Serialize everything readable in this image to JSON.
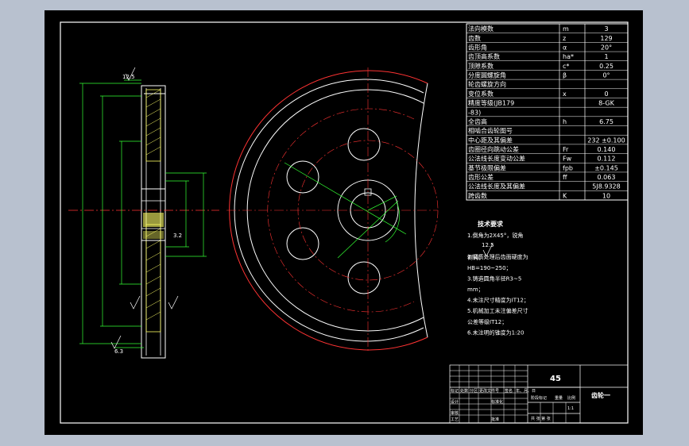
{
  "params": [
    {
      "name": "法向模数",
      "sym": "m",
      "val": "3"
    },
    {
      "name": "齿数",
      "sym": "z",
      "val": "129"
    },
    {
      "name": "齿形角",
      "sym": "α",
      "val": "20°"
    },
    {
      "name": "齿顶高系数",
      "sym": "ha*",
      "val": "1"
    },
    {
      "name": "顶隙系数",
      "sym": "c*",
      "val": "0.25"
    },
    {
      "name": "分度圆螺旋角",
      "sym": "β",
      "val": "0°"
    },
    {
      "name": "轮齿螺旋方向",
      "sym": "",
      "val": ""
    },
    {
      "name": "变位系数",
      "sym": "x",
      "val": "0"
    },
    {
      "name": "精度等级(JB179",
      "sym": "",
      "val": "8-GK"
    },
    {
      "name": "-83)",
      "sym": "",
      "val": ""
    },
    {
      "name": "全齿高",
      "sym": "h",
      "val": "6.75"
    },
    {
      "name": "相啮合齿轮图号",
      "sym": "",
      "val": ""
    },
    {
      "name": "中心距及其偏差",
      "sym": "",
      "val": "232 ±0.100"
    },
    {
      "name": "齿圈径向跳动公差",
      "sym": "Fr",
      "val": "0.140"
    },
    {
      "name": "公法线长度变动公差",
      "sym": "Fw",
      "val": "0.112"
    },
    {
      "name": "基节极限偏差",
      "sym": "fpb",
      "val": "±0.145"
    },
    {
      "name": "齿形公差",
      "sym": "ff",
      "val": "0.063"
    },
    {
      "name": "公法线长度及其偏差",
      "sym": "",
      "val": "5J8.9328"
    },
    {
      "name": "跨齿数",
      "sym": "K",
      "val": "10"
    }
  ],
  "notes": {
    "title": "技术要求",
    "lines": [
      "1.倒角为2X45°，锐角",
      "倒钝；",
      "2.调质处理后齿面硬度为",
      "HB=190~250；",
      "3.铸造圆角半径R3~5",
      "mm；",
      "4.未注尺寸精度为IT12；",
      "5.机械加工未注偏差尺寸",
      "公差等级IT12；",
      "6.未注明的锥度为1:20"
    ]
  },
  "title_block": {
    "material": "45",
    "part_name": "齿轮一",
    "h1": "标记",
    "h2": "处数",
    "h3": "分区",
    "h4": "更改文件号",
    "h5": "签名",
    "h6": "年、月、日",
    "design": "设计",
    "standard": "标准化",
    "stage": "阶段标记",
    "weight": "重量",
    "scale": "比例",
    "scale_val": "1:1",
    "review": "审核",
    "craft": "工艺",
    "approve": "批准",
    "sheets": "共 张 第 张"
  },
  "section_marks": {
    "rough": "3.2",
    "r1": "12.5",
    "r2": "6.3"
  },
  "colors": {
    "bg": "#000000",
    "frame": "#ffffff",
    "accent": "#ff3333",
    "dim": "#33ff33",
    "text": "#ffffff",
    "hatch": "#ffff66"
  }
}
